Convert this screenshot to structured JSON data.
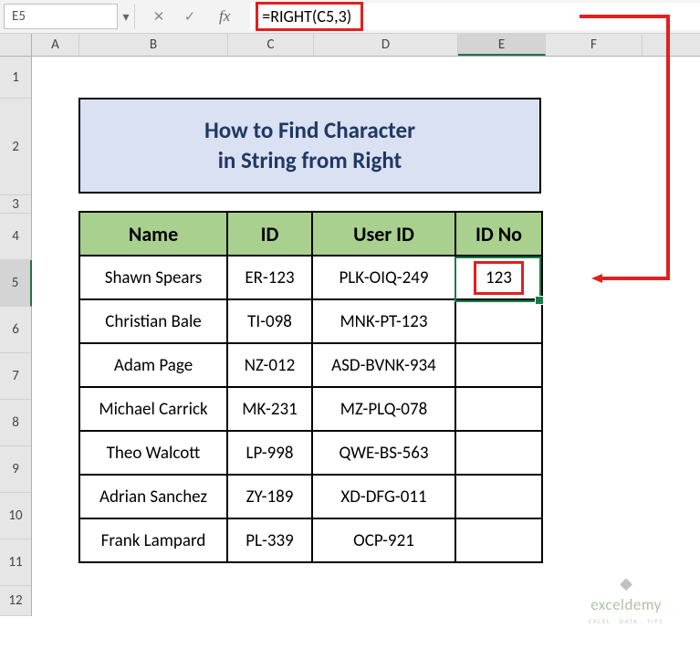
{
  "name_box": "E5",
  "formula": "=RIGHT(C5,3)",
  "fx_label": "fx",
  "columns": [
    "A",
    "B",
    "C",
    "D",
    "E",
    "F"
  ],
  "rows": [
    "1",
    "2",
    "3",
    "4",
    "5",
    "6",
    "7",
    "8",
    "9",
    "10",
    "11",
    "12"
  ],
  "title_line1": "How to Find Character",
  "title_line2": "in String from Right",
  "headers": {
    "name": "Name",
    "id": "ID",
    "user_id": "User ID",
    "id_no": "ID No"
  },
  "table": [
    {
      "name": "Shawn Spears",
      "id": "ER-123",
      "user_id": "PLK-OIQ-249",
      "id_no": "123"
    },
    {
      "name": "Christian Bale",
      "id": "TI-098",
      "user_id": "MNK-PT-123",
      "id_no": ""
    },
    {
      "name": "Adam Page",
      "id": "NZ-012",
      "user_id": "ASD-BVNK-934",
      "id_no": ""
    },
    {
      "name": "Michael Carrick",
      "id": "MK-231",
      "user_id": "MZ-PLQ-078",
      "id_no": ""
    },
    {
      "name": "Theo Walcott",
      "id": "LP-998",
      "user_id": "QWE-BS-563",
      "id_no": ""
    },
    {
      "name": "Adrian Sanchez",
      "id": "ZY-189",
      "user_id": "XD-DFG-011",
      "id_no": ""
    },
    {
      "name": "Frank Lampard",
      "id": "PL-339",
      "user_id": "OCP-921",
      "id_no": ""
    }
  ],
  "watermark": {
    "name": "exceldemy",
    "sub": "EXCEL · DATA · TIPS"
  }
}
